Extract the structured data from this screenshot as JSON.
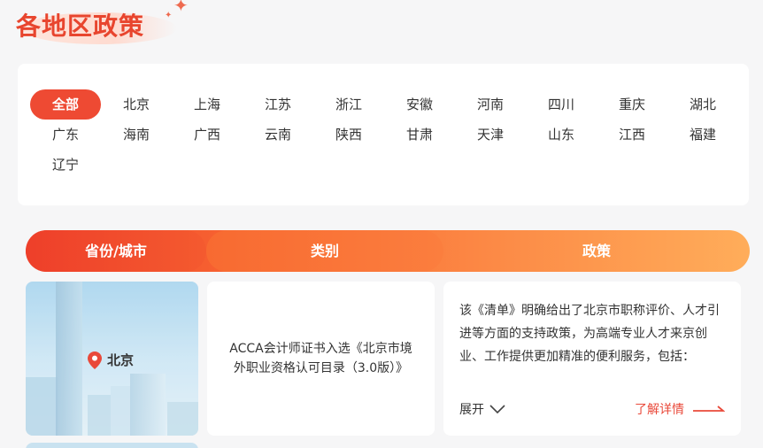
{
  "section": {
    "title": "各地区政策"
  },
  "regions": {
    "items": [
      "全部",
      "北京",
      "上海",
      "江苏",
      "浙江",
      "安徽",
      "河南",
      "四川",
      "重庆",
      "湖北",
      "广东",
      "海南",
      "广西",
      "云南",
      "陕西",
      "甘肃",
      "天津",
      "山东",
      "江西",
      "福建",
      "辽宁"
    ],
    "active_index": 0
  },
  "table": {
    "headers": [
      "省份/城市",
      "类别",
      "政策"
    ],
    "rows": [
      {
        "city": "北京",
        "category": "ACCA会计师证书入选《北京市境外职业资格认可目录（3.0版）》",
        "policy": "该《清单》明确给出了北京市职称评价、人才引进等方面的支持政策，为高端专业人才来京创业、工作提供更加精准的便利服务，包括：",
        "expand_label": "展开",
        "more_label": "了解详情"
      }
    ]
  },
  "colors": {
    "accent": "#ee4a33",
    "gradient_end": "#ffad5a",
    "link": "#e9493a"
  },
  "icons": {
    "pin": "location-pin-icon",
    "expand": "chevron-down-icon",
    "more": "arrow-right-icon"
  }
}
